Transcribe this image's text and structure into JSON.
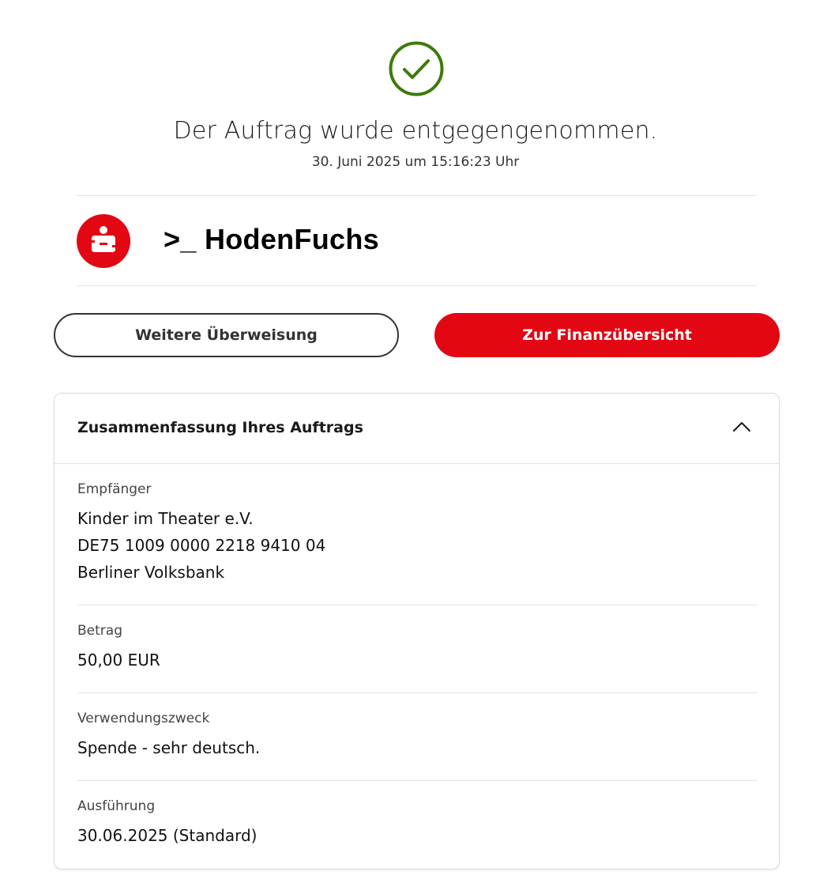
{
  "confirmation": {
    "icon": "check-circle-icon",
    "icon_color": "#3d7a0a",
    "headline": "Der Auftrag wurde entgegengenommen.",
    "timestamp": "30. Juni 2025 um 15:16:23 Uhr"
  },
  "account": {
    "logo": "sparkasse-logo",
    "logo_color": "#e30613",
    "name": ">_ HodenFuchs"
  },
  "actions": {
    "secondary_label": "Weitere Überweisung",
    "primary_label": "Zur Finanzübersicht",
    "primary_color": "#e30613"
  },
  "summary": {
    "title": "Zusammenfassung Ihres Auftrags",
    "toggle_icon": "chevron-up-icon",
    "recipient": {
      "label": "Empfänger",
      "name": "Kinder im Theater e.V.",
      "iban": "DE75 1009 0000 2218 9410 04",
      "bank": "Berliner Volksbank"
    },
    "amount": {
      "label": "Betrag",
      "value": "50,00 EUR"
    },
    "purpose": {
      "label": "Verwendungszweck",
      "value": "Spende - sehr deutsch."
    },
    "execution": {
      "label": "Ausführung",
      "value": "30.06.2025 (Standard)"
    }
  }
}
